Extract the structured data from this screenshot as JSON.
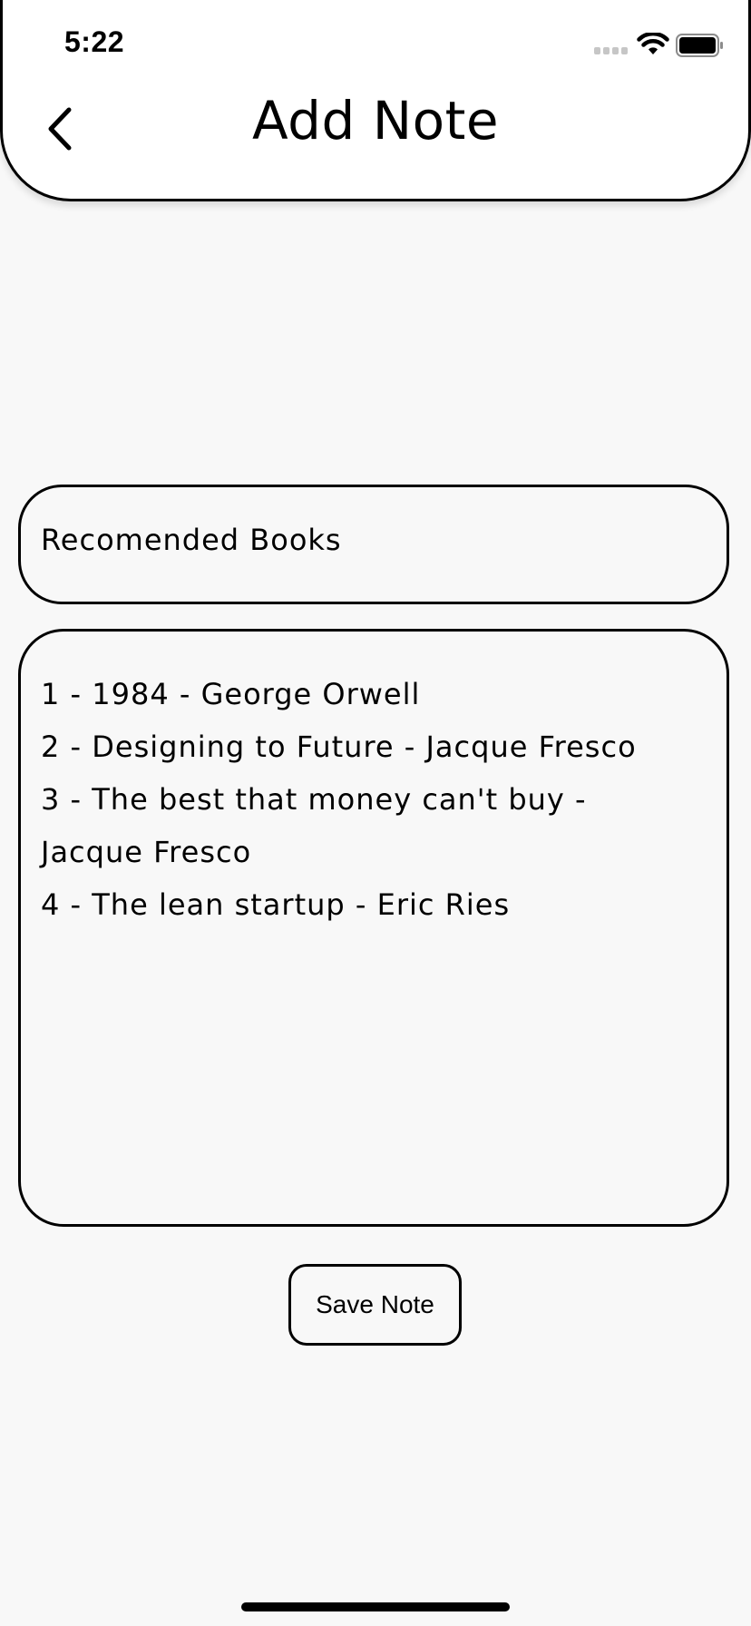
{
  "status_bar": {
    "time": "5:22"
  },
  "header": {
    "title": "Add Note",
    "back_icon": "chevron-left-icon"
  },
  "note": {
    "title": "Recomended Books",
    "body_lines": [
      "1 - 1984 - George Orwell",
      "2 - Designing to Future - Jacque Fresco",
      "3 - The best that money can't buy -",
      "Jacque Fresco",
      "4 - The lean startup - Eric Ries"
    ]
  },
  "actions": {
    "save_label": "Save Note"
  },
  "colors": {
    "background": "#f8f8f8",
    "header_background": "#ffffff",
    "border": "#000000"
  }
}
